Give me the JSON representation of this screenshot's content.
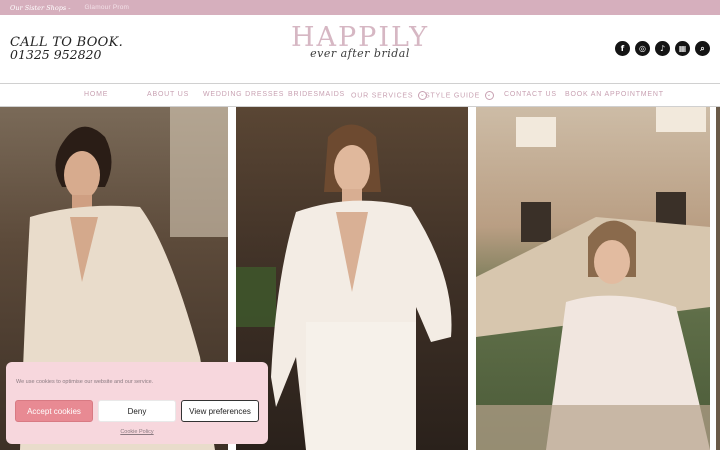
{
  "topbar": {
    "sister_label": "Our Sister Shops -",
    "sister_link": "Glamour Prom"
  },
  "header": {
    "call_line1": "CALL TO BOOK.",
    "call_line2": "01325 952820",
    "logo_main": "HAPPILY",
    "logo_script": "ever after bridal",
    "social": [
      {
        "icon": "facebook-icon",
        "glyph": "f"
      },
      {
        "icon": "instagram-icon",
        "glyph": "◎"
      },
      {
        "icon": "tiktok-icon",
        "glyph": "♪"
      },
      {
        "icon": "calendar-icon",
        "glyph": "▦"
      },
      {
        "icon": "search-icon",
        "glyph": "⌕"
      }
    ]
  },
  "nav": {
    "home": "HOME",
    "about": "ABOUT US",
    "wedding": "WEDDING DRESSES",
    "bridesmaids": "BRIDESMAIDS",
    "services": "OUR SERVICES",
    "style": "STYLE GUIDE",
    "contact": "CONTACT US",
    "book": "BOOK AN APPOINTMENT",
    "chevron": "⌄"
  },
  "cookie": {
    "message": "We use cookies to optimise our website and our service.",
    "accept": "Accept cookies",
    "deny": "Deny",
    "preferences": "View preferences",
    "policy": "Cookie Policy"
  },
  "colors": {
    "brand_pink": "#d6afbd",
    "nav_text": "#c8a1b2",
    "accept_button": "#e88a93",
    "cookie_bg": "#f7d7dd"
  }
}
